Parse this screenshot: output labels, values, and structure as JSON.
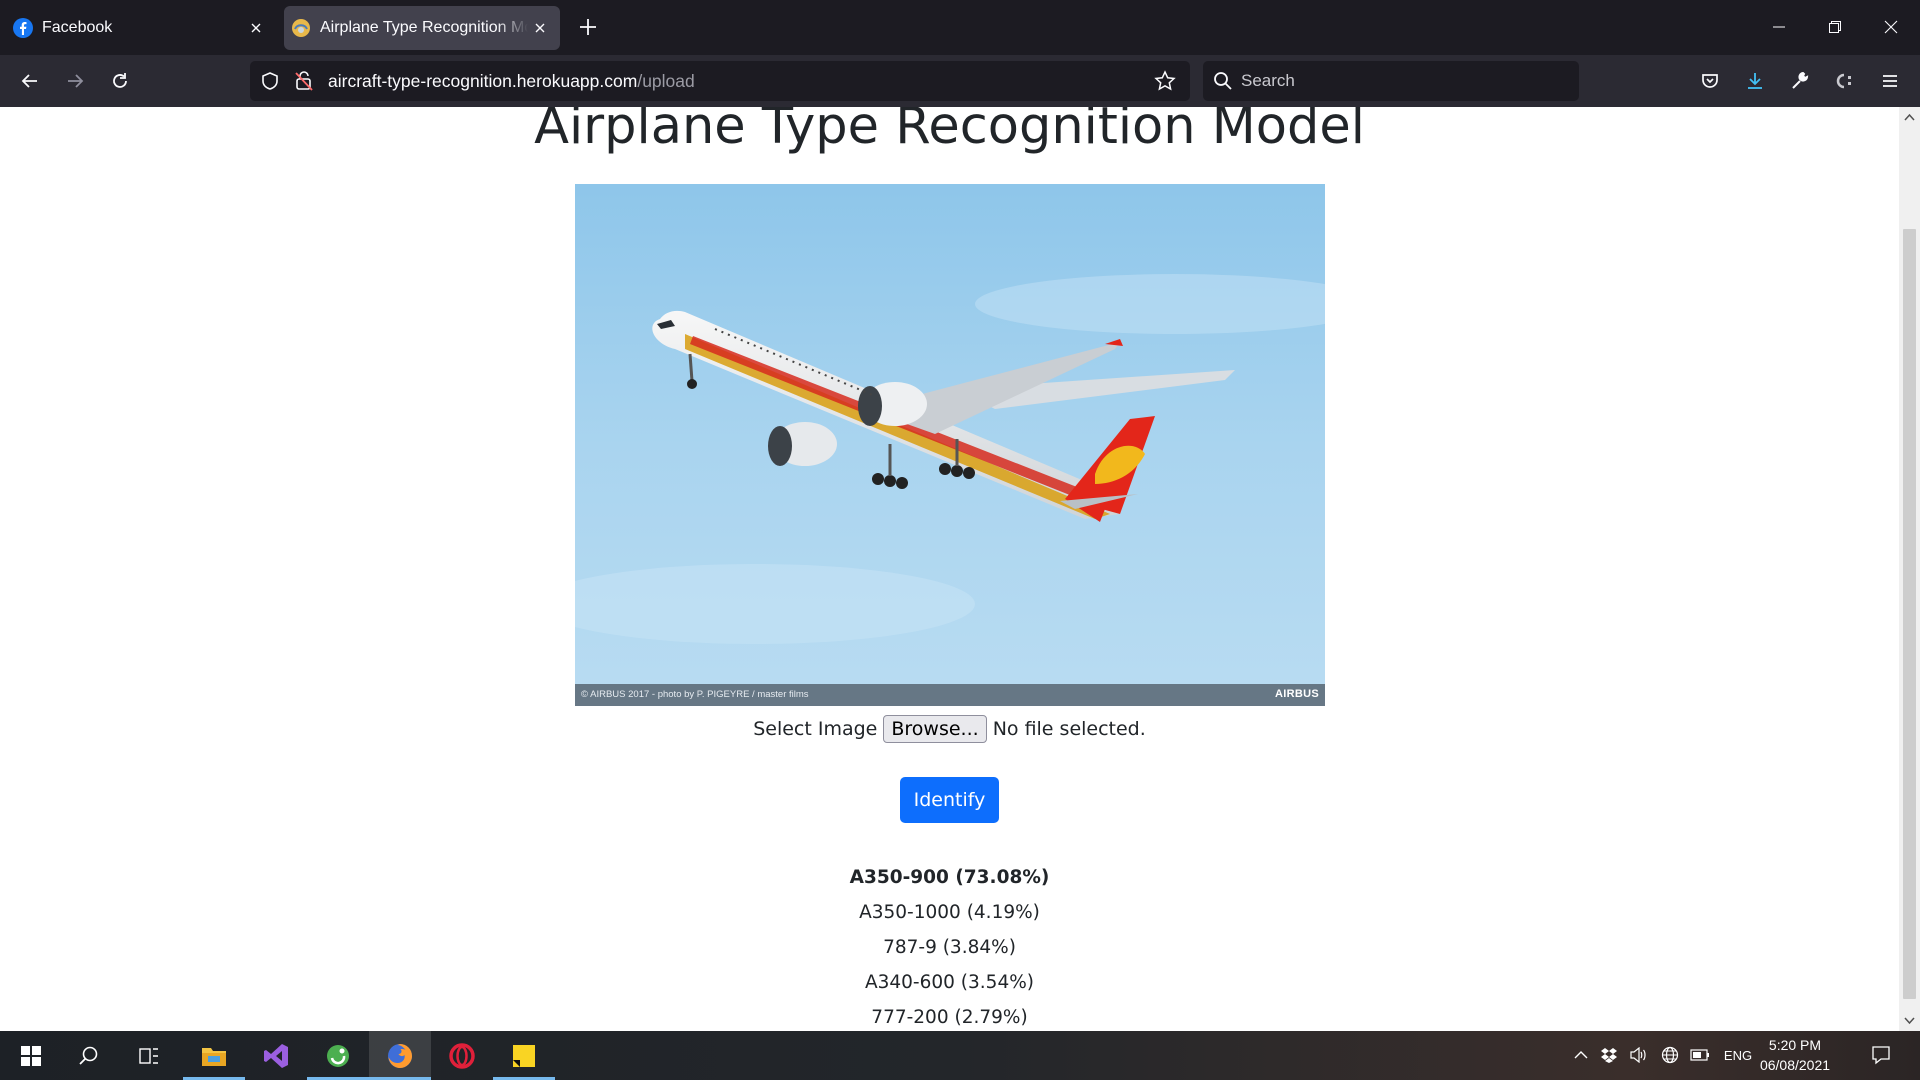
{
  "browser": {
    "tabs": [
      {
        "title": "Facebook",
        "favicon": "facebook-icon",
        "active": false
      },
      {
        "title": "Airplane Type Recognition Model",
        "favicon": "app-favicon",
        "active": true
      }
    ],
    "url_domain": "aircraft-type-recognition.herokuapp.com",
    "url_path": "/upload",
    "search_placeholder": "Search"
  },
  "page": {
    "title": "Airplane Type Recognition Model",
    "image": {
      "credit": "© AIRBUS 2017 - photo by P. PIGEYRE / master films",
      "brand": "AIRBUS"
    },
    "file_input": {
      "label": "Select Image",
      "button": "Browse...",
      "status": "No file selected."
    },
    "identify_button": "Identify",
    "predictions": [
      "A350-900 (73.08%)",
      "A350-1000 (4.19%)",
      "787-9 (3.84%)",
      "A340-600 (3.54%)",
      "777-200 (2.79%)"
    ]
  },
  "taskbar": {
    "language": "ENG",
    "time": "5:20 PM",
    "date": "06/08/2021"
  },
  "colors": {
    "accent_button": "#0d6efd",
    "chrome_dark": "#1c1b22",
    "toolbar": "#2b2a33"
  }
}
